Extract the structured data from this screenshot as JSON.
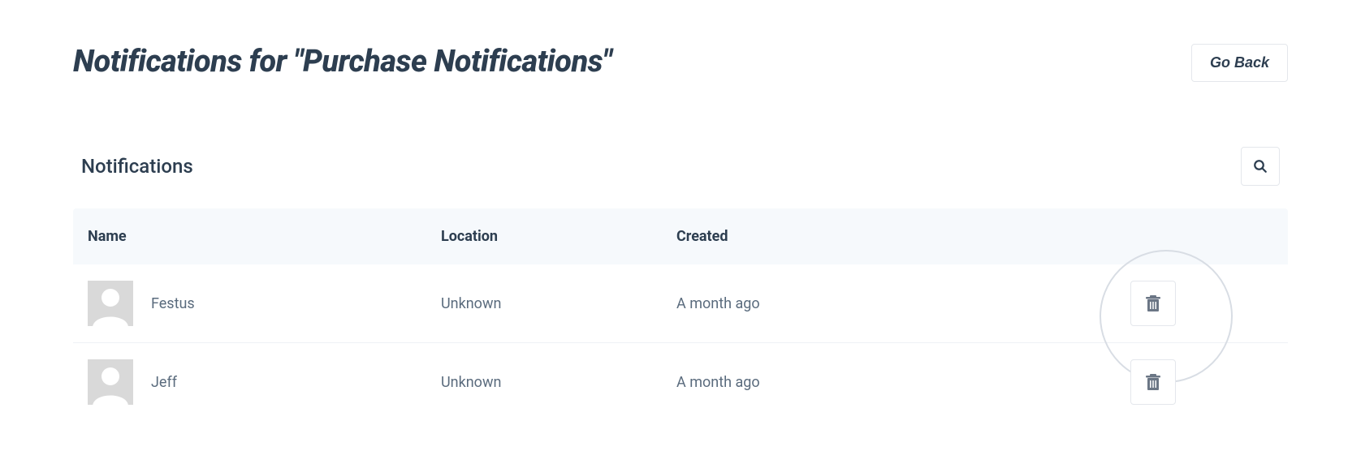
{
  "header": {
    "title": "Notifications for \"Purchase Notifications\"",
    "goBackLabel": "Go Back"
  },
  "section": {
    "title": "Notifications"
  },
  "table": {
    "columns": {
      "name": "Name",
      "location": "Location",
      "created": "Created"
    },
    "rows": [
      {
        "name": "Festus",
        "location": "Unknown",
        "created": "A month ago"
      },
      {
        "name": "Jeff",
        "location": "Unknown",
        "created": "A month ago"
      }
    ]
  }
}
